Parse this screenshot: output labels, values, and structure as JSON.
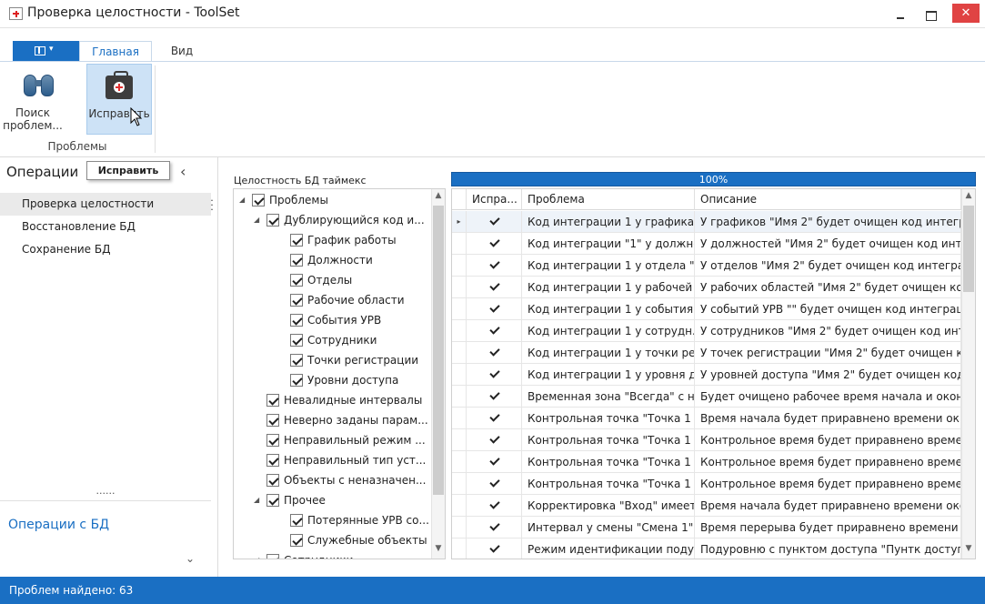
{
  "window": {
    "title": "Проверка целостности - ToolSet",
    "close_glyph": "✕"
  },
  "ribbon": {
    "tabs": [
      {
        "label": "Главная"
      },
      {
        "label": "Вид"
      }
    ],
    "buttons": {
      "find": "Поиск\nпроблем...",
      "fix": "Исправить"
    },
    "group_label": "Проблемы"
  },
  "tooltip": "Исправить",
  "left_panel": {
    "header": "Операции",
    "items": [
      {
        "label": "Проверка целостности"
      },
      {
        "label": "Восстановление БД"
      },
      {
        "label": "Сохранение БД"
      }
    ],
    "divider_dots": "......",
    "footer_link": "Операции с БД"
  },
  "main": {
    "db_label": "Целостность БД таймекс",
    "progress": {
      "value": 1.0,
      "label": "100%"
    }
  },
  "tree": [
    {
      "level": 0,
      "expand": "◢",
      "label": "Проблемы"
    },
    {
      "level": 1,
      "expand": "◢",
      "label": "Дублирующийся код и..."
    },
    {
      "level": 2,
      "expand": "",
      "label": "График работы"
    },
    {
      "level": 2,
      "expand": "",
      "label": "Должности"
    },
    {
      "level": 2,
      "expand": "",
      "label": "Отделы"
    },
    {
      "level": 2,
      "expand": "",
      "label": "Рабочие области"
    },
    {
      "level": 2,
      "expand": "",
      "label": "События УРВ"
    },
    {
      "level": 2,
      "expand": "",
      "label": "Сотрудники"
    },
    {
      "level": 2,
      "expand": "",
      "label": "Точки регистрации"
    },
    {
      "level": 2,
      "expand": "",
      "label": "Уровни доступа"
    },
    {
      "level": 1,
      "expand": "",
      "label": "Невалидные интервалы"
    },
    {
      "level": 1,
      "expand": "",
      "label": "Неверно заданы парам..."
    },
    {
      "level": 1,
      "expand": "",
      "label": "Неправильный режим ..."
    },
    {
      "level": 1,
      "expand": "",
      "label": "Неправильный тип уст..."
    },
    {
      "level": 1,
      "expand": "",
      "label": "Объекты с неназначен..."
    },
    {
      "level": 1,
      "expand": "◢",
      "label": "Прочее"
    },
    {
      "level": 2,
      "expand": "",
      "label": "Потерянные УРВ со..."
    },
    {
      "level": 2,
      "expand": "",
      "label": "Служебные объекты"
    },
    {
      "level": 1,
      "expand": "◢",
      "label": "Сотрудники"
    }
  ],
  "grid": {
    "columns": [
      "Испра...",
      "Проблема",
      "Описание"
    ],
    "rows": [
      {
        "fix": true,
        "problem": "Код интеграции 1 у графика ...",
        "description": "У графиков \"Имя 2\" будет очищен код интегр..."
      },
      {
        "fix": true,
        "problem": "Код интеграции \"1\" у должно...",
        "description": "У должностей \"Имя 2\" будет очищен код инт..."
      },
      {
        "fix": true,
        "problem": "Код интеграции 1 у отдела \"...",
        "description": "У отделов \"Имя 2\" будет очищен код интегра..."
      },
      {
        "fix": true,
        "problem": "Код интеграции 1 у рабочей ...",
        "description": "У рабочих областей \"Имя 2\" будет очищен ко..."
      },
      {
        "fix": true,
        "problem": "Код интеграции 1 у события ...",
        "description": "У событий УРВ \"\" будет очищен код интеграции"
      },
      {
        "fix": true,
        "problem": "Код интеграции 1 у сотрудн...",
        "description": "У сотрудников \"Имя 2\" будет очищен код инт..."
      },
      {
        "fix": true,
        "problem": "Код интеграции 1 у точки ре...",
        "description": "У точек регистрации \"Имя 2\" будет очищен к..."
      },
      {
        "fix": true,
        "problem": "Код интеграции 1 у уровня д...",
        "description": "У уровней доступа \"Имя 2\" будет очищен код..."
      },
      {
        "fix": true,
        "problem": "Временная зона \"Всегда\" с не...",
        "description": "Будет очищено рабочее время начала и окон..."
      },
      {
        "fix": true,
        "problem": "Контрольная точка \"Точка 1 ...",
        "description": "Время начала будет приравнено времени ок..."
      },
      {
        "fix": true,
        "problem": "Контрольная точка \"Точка 1 ...",
        "description": "Контрольное время будет приравнено време..."
      },
      {
        "fix": true,
        "problem": "Контрольная точка \"Точка 1 ...",
        "description": "Контрольное время будет приравнено време..."
      },
      {
        "fix": true,
        "problem": "Контрольная точка \"Точка 1 ...",
        "description": "Контрольное время будет приравнено време..."
      },
      {
        "fix": true,
        "problem": "Корректировка \"Вход\" имеет...",
        "description": "Время начала будет приравнено времени око..."
      },
      {
        "fix": true,
        "problem": "Интервал у смены \"Смена 1\" ...",
        "description": "Время перерыва будет приравнено времени и..."
      },
      {
        "fix": true,
        "problem": "Режим идентификации подур...",
        "description": "Подуровню с пунктом доступа \"Пунтк доступ..."
      }
    ]
  },
  "status": "Проблем найдено: 63",
  "colors": {
    "accent": "#1a6fc3",
    "selection": "#cde2f6",
    "close": "#e04343"
  }
}
